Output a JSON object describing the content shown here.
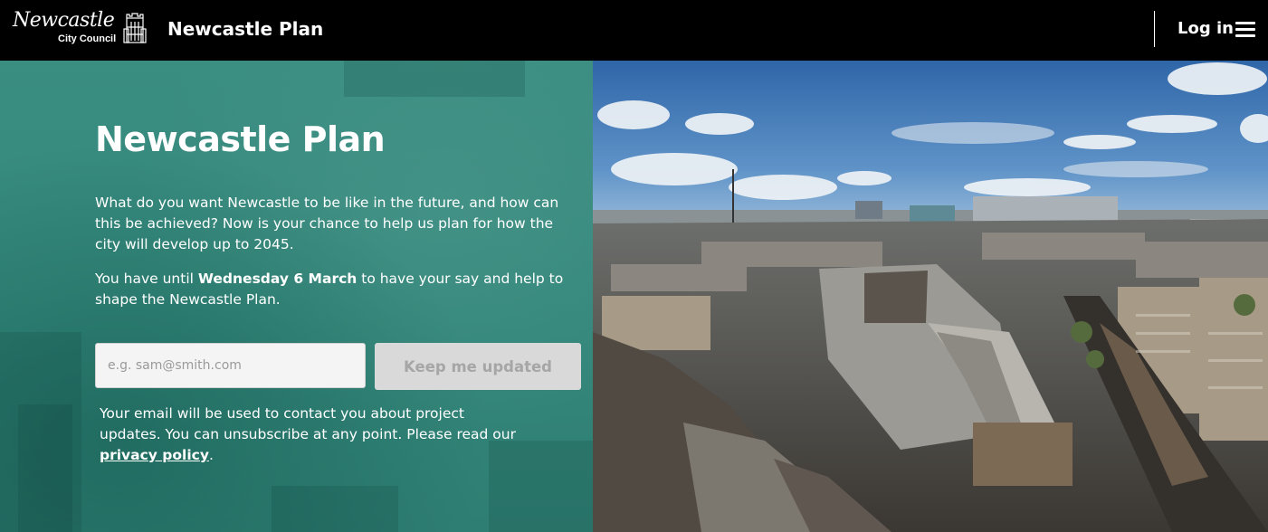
{
  "header": {
    "logo_script": "Newcastle",
    "logo_sub": "City Council",
    "site_title": "Newcastle Plan",
    "login_label": "Log in",
    "menu_icon": "hamburger-menu-icon"
  },
  "hero": {
    "title": "Newcastle Plan",
    "intro": "What do you want Newcastle to be like in the future, and how can this be achieved? Now is your chance to help us plan for how the city will develop up to 2045.",
    "deadline_prefix": "You have until ",
    "deadline_date": "Wednesday 6 March",
    "deadline_suffix": " to have your say and help to shape the Newcastle Plan.",
    "email_placeholder": "e.g. sam@smith.com",
    "email_value": "",
    "submit_label": "Keep me updated",
    "notice_text": "Your email will be used to contact you about project updates. You can unsubscribe at any point. Please read our ",
    "privacy_link": "privacy policy",
    "notice_end": "."
  },
  "colors": {
    "header_bg": "#000000",
    "panel_teal": "#37897d",
    "button_disabled_bg": "#d9d9d9",
    "button_disabled_text": "#a6a6a6",
    "sky": "#3c73b4"
  }
}
